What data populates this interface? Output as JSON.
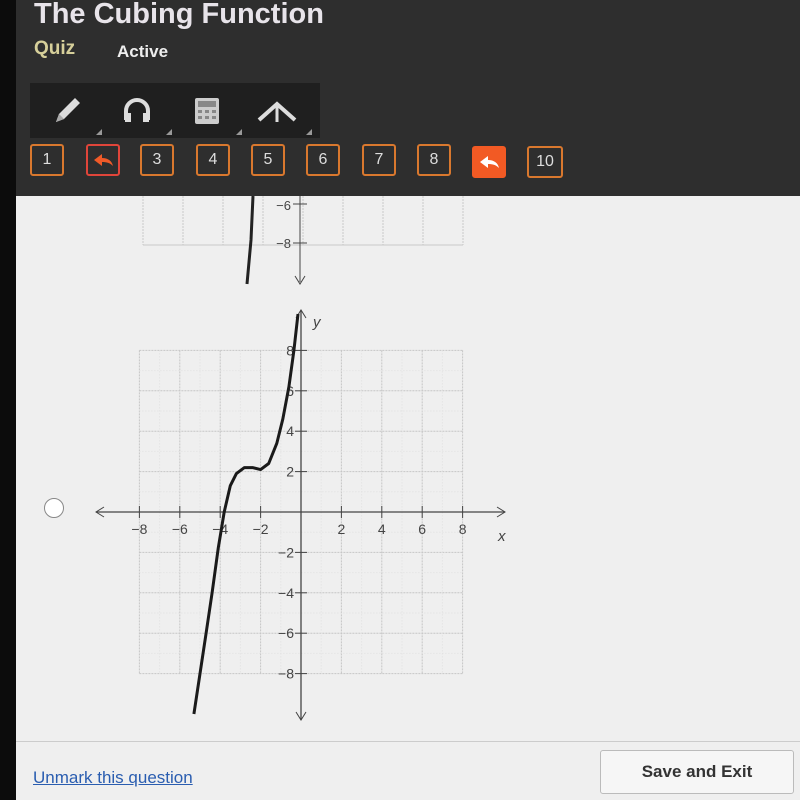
{
  "header": {
    "title": "The Cubing Function",
    "type": "Quiz",
    "status": "Active"
  },
  "toolbar": {
    "tools": [
      {
        "icon": "pencil-icon"
      },
      {
        "icon": "headphones-icon"
      },
      {
        "icon": "calculator-icon"
      },
      {
        "icon": "up-caret-icon"
      }
    ]
  },
  "question_nav": [
    {
      "label": "1",
      "state": "normal"
    },
    {
      "label": "",
      "state": "marked",
      "icon": "reply-arrow-icon"
    },
    {
      "label": "3",
      "state": "normal"
    },
    {
      "label": "4",
      "state": "normal"
    },
    {
      "label": "5",
      "state": "normal"
    },
    {
      "label": "6",
      "state": "normal"
    },
    {
      "label": "7",
      "state": "normal"
    },
    {
      "label": "8",
      "state": "normal"
    },
    {
      "label": "",
      "state": "current",
      "icon": "reply-arrow-icon"
    },
    {
      "label": "10",
      "state": "normal"
    }
  ],
  "previous_option_partial": {
    "tick_labels": [
      "−6",
      "−8"
    ]
  },
  "chart_data": {
    "type": "line",
    "xlabel": "x",
    "ylabel": "y",
    "xlim": [
      -8,
      8
    ],
    "ylim": [
      -8,
      8
    ],
    "grid": true,
    "x_ticks": [
      "−8",
      "−6",
      "−4",
      "−2",
      "2",
      "4",
      "6",
      "8"
    ],
    "y_ticks": [
      "8",
      "6",
      "4",
      "2",
      "−2",
      "−4",
      "−6",
      "−8"
    ],
    "x": [
      -5.3,
      -5,
      -4.7,
      -4.4,
      -4.1,
      -3.8,
      -3.5,
      -3.2,
      -2.8,
      -2.4,
      -2,
      -1.6,
      -1.2,
      -0.9,
      -0.6,
      -0.35,
      -0.15
    ],
    "y": [
      -10,
      -8,
      -6,
      -4,
      -1.8,
      0,
      1.3,
      1.9,
      2.2,
      2.2,
      2.1,
      2.4,
      3.4,
      4.6,
      6.2,
      8,
      9.8
    ]
  },
  "footer": {
    "unmark_label": "Unmark this question",
    "save_label": "Save and Exit"
  },
  "colors": {
    "accent": "#f25a24",
    "nav_border": "#d9782e",
    "header_bg": "#2e2e2e"
  }
}
